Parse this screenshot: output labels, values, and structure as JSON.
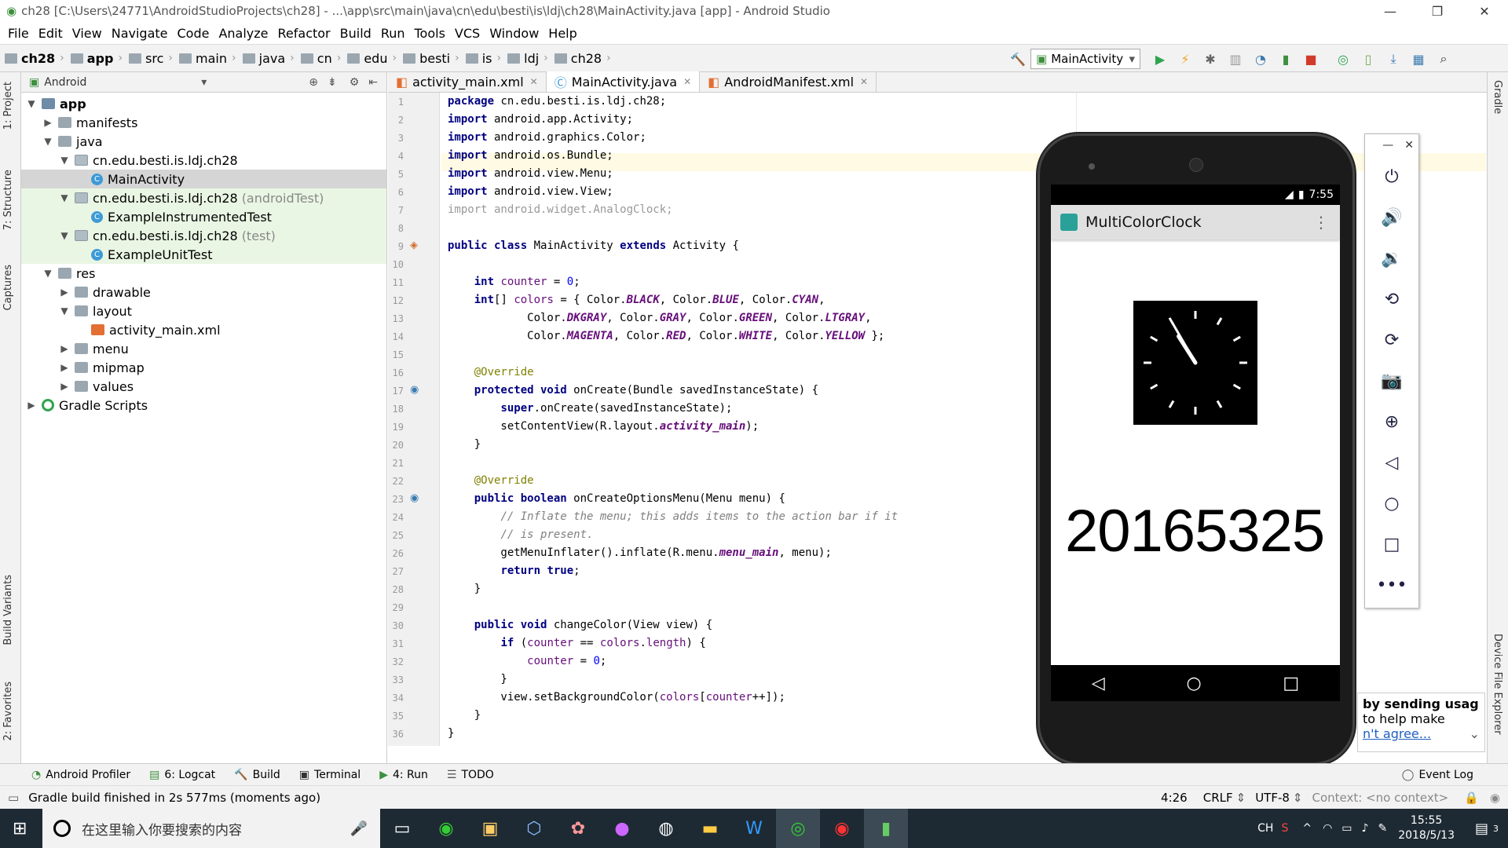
{
  "window": {
    "title": "ch28 [C:\\Users\\24771\\AndroidStudioProjects\\ch28] - ...\\app\\src\\main\\java\\cn\\edu\\besti\\is\\ldj\\ch28\\MainActivity.java [app] - Android Studio"
  },
  "menu": [
    "File",
    "Edit",
    "View",
    "Navigate",
    "Code",
    "Analyze",
    "Refactor",
    "Build",
    "Run",
    "Tools",
    "VCS",
    "Window",
    "Help"
  ],
  "breadcrumb": [
    "ch28",
    "app",
    "src",
    "main",
    "java",
    "cn",
    "edu",
    "besti",
    "is",
    "ldj",
    "ch28"
  ],
  "run_config": "MainActivity",
  "project_panel": {
    "view_mode": "Android",
    "tree": [
      {
        "depth": 0,
        "label": "app",
        "twisty": "▼",
        "icon": "mod",
        "bold": true
      },
      {
        "depth": 1,
        "label": "manifests",
        "twisty": "▶",
        "icon": "folder"
      },
      {
        "depth": 1,
        "label": "java",
        "twisty": "▼",
        "icon": "folder"
      },
      {
        "depth": 2,
        "label": "cn.edu.besti.is.ldj.ch28",
        "twisty": "▼",
        "icon": "pkg"
      },
      {
        "depth": 3,
        "label": "MainActivity",
        "twisty": "",
        "icon": "java",
        "selected": true
      },
      {
        "depth": 2,
        "label": "cn.edu.besti.is.ldj.ch28",
        "suffix": "(androidTest)",
        "twisty": "▼",
        "icon": "pkg",
        "green": true
      },
      {
        "depth": 3,
        "label": "ExampleInstrumentedTest",
        "twisty": "",
        "icon": "java",
        "green": true
      },
      {
        "depth": 2,
        "label": "cn.edu.besti.is.ldj.ch28",
        "suffix": "(test)",
        "twisty": "▼",
        "icon": "pkg",
        "green": true
      },
      {
        "depth": 3,
        "label": "ExampleUnitTest",
        "twisty": "",
        "icon": "java",
        "green": true
      },
      {
        "depth": 1,
        "label": "res",
        "twisty": "▼",
        "icon": "folder"
      },
      {
        "depth": 2,
        "label": "drawable",
        "twisty": "▶",
        "icon": "folder"
      },
      {
        "depth": 2,
        "label": "layout",
        "twisty": "▼",
        "icon": "folder"
      },
      {
        "depth": 3,
        "label": "activity_main.xml",
        "twisty": "",
        "icon": "xml"
      },
      {
        "depth": 2,
        "label": "menu",
        "twisty": "▶",
        "icon": "folder"
      },
      {
        "depth": 2,
        "label": "mipmap",
        "twisty": "▶",
        "icon": "folder"
      },
      {
        "depth": 2,
        "label": "values",
        "twisty": "▶",
        "icon": "folder"
      },
      {
        "depth": 0,
        "label": "Gradle Scripts",
        "twisty": "▶",
        "icon": "gradle"
      }
    ]
  },
  "left_tool_windows": [
    "1: Project",
    "7: Structure",
    "Captures",
    "Build Variants",
    "2: Favorites"
  ],
  "right_tool_windows": [
    "Gradle",
    "Device File Explorer"
  ],
  "editor_tabs": [
    {
      "label": "activity_main.xml",
      "active": false,
      "icon": "xml"
    },
    {
      "label": "MainActivity.java",
      "active": true,
      "icon": "java"
    },
    {
      "label": "AndroidManifest.xml",
      "active": false,
      "icon": "xml"
    }
  ],
  "code_lines": [
    "<span class=\"kw\">package</span> cn.edu.besti.is.ldj.ch28;",
    "<span class=\"kw\">import</span> android.app.Activity;",
    "<span class=\"kw\">import</span> android.graphics.Color;",
    "<span class=\"kw\">import</span> android.os.Bundle;",
    "<span class=\"kw\">import</span> android.view.Menu;",
    "<span class=\"kw\">import</span> android.view.View;",
    "<span class=\"dim\">import android.widget.AnalogClock;</span>",
    "",
    "<span class=\"kw\">public class</span> MainActivity <span class=\"kw\">extends</span> Activity {",
    "",
    "    <span class=\"kw\">int</span> <span class=\"fld\">counter</span> = <span class=\"num\">0</span>;",
    "    <span class=\"kw\">int</span>[] <span class=\"fld\">colors</span> = { Color.<span class=\"cn\">BLACK</span>, Color.<span class=\"cn\">BLUE</span>, Color.<span class=\"cn\">CYAN</span>,",
    "            Color.<span class=\"cn\">DKGRAY</span>, Color.<span class=\"cn\">GRAY</span>, Color.<span class=\"cn\">GREEN</span>, Color.<span class=\"cn\">LTGRAY</span>,",
    "            Color.<span class=\"cn\">MAGENTA</span>, Color.<span class=\"cn\">RED</span>, Color.<span class=\"cn\">WHITE</span>, Color.<span class=\"cn\">YELLOW</span> };",
    "",
    "    <span class=\"ann\">@Override</span>",
    "    <span class=\"kw\">protected void</span> onCreate(Bundle savedInstanceState) {",
    "        <span class=\"kw\">super</span>.onCreate(savedInstanceState);",
    "        setContentView(R.layout.<span class=\"cn\">activity_main</span>);",
    "    }",
    "",
    "    <span class=\"ann\">@Override</span>",
    "    <span class=\"kw\">public boolean</span> onCreateOptionsMenu(Menu menu) {",
    "        <span class=\"com\">// Inflate the menu; this adds items to the action bar if it</span>",
    "        <span class=\"com\">// is present.</span>",
    "        getMenuInflater().inflate(R.menu.<span class=\"cn\">menu_main</span>, menu);",
    "        <span class=\"kw\">return true</span>;",
    "    }",
    "",
    "    <span class=\"kw\">public void</span> changeColor(View view) {",
    "        <span class=\"kw\">if</span> (<span class=\"fld\">counter</span> == <span class=\"fld\">colors</span>.<span class=\"fld\">length</span>) {",
    "            <span class=\"fld\">counter</span> = <span class=\"num\">0</span>;",
    "        }",
    "        view.setBackgroundColor(<span class=\"fld\">colors</span>[<span class=\"fld\">counter</span>++]);",
    "    }",
    "}"
  ],
  "bottom_tools": [
    "Android Profiler",
    "6: Logcat",
    "Build",
    "Terminal",
    "4: Run",
    "TODO",
    "Event Log"
  ],
  "status": {
    "message": "Gradle build finished in 2s 577ms (moments ago)",
    "position": "4:26",
    "line_sep": "CRLF",
    "encoding": "UTF-8",
    "context": "Context: <no context>"
  },
  "emulator": {
    "time": "7:55",
    "app_title": "MultiColorClock",
    "number_text": "20165325",
    "clock_hour": 10,
    "clock_minute": 55,
    "controls": [
      "power-icon",
      "volume-up-icon",
      "volume-down-icon",
      "rotate-left-icon",
      "rotate-right-icon",
      "camera-icon",
      "zoom-icon",
      "back-icon",
      "home-icon",
      "overview-icon",
      "more-icon"
    ]
  },
  "notification": {
    "line1": "by sending usag",
    "line2": "to help make",
    "link": "n't agree..."
  },
  "taskbar": {
    "search_placeholder": "在这里输入你要搜索的内容",
    "ime": "CH",
    "time": "15:55",
    "date": "2018/5/13",
    "notif_count": "3"
  }
}
